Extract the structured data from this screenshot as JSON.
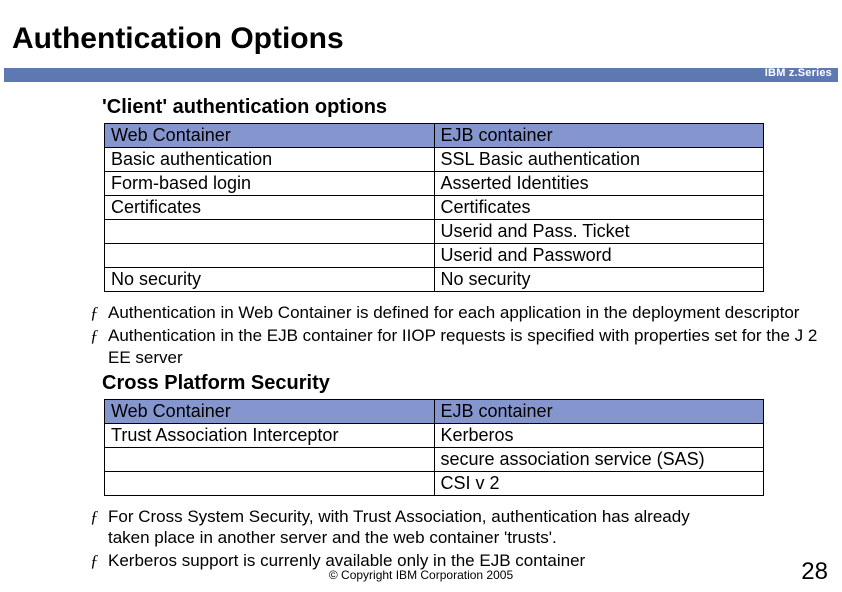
{
  "slide": {
    "title": "Authentication Options",
    "brand": "IBM z.Series",
    "section1": {
      "heading": "'Client' authentication options",
      "rows": [
        {
          "left": "Web Container",
          "right": "EJB container",
          "header": true
        },
        {
          "left": "Basic authentication",
          "right": "SSL Basic authentication"
        },
        {
          "left": "Form-based login",
          "right": "Asserted Identities"
        },
        {
          "left": "Certificates",
          "right": "Certificates"
        },
        {
          "left": "",
          "right": "Userid and Pass. Ticket"
        },
        {
          "left": "",
          "right": "Userid and Password"
        },
        {
          "left": "No security",
          "right": "No security"
        }
      ]
    },
    "bullets1": [
      "Authentication in Web Container is defined for each application in the deployment descriptor",
      "Authentication in the EJB container for IIOP requests is specified with properties set for the J 2 EE server"
    ],
    "section2": {
      "heading": "Cross Platform Security",
      "rows": [
        {
          "left": "Web Container",
          "right": "EJB container",
          "header": true
        },
        {
          "left": "Trust Association Interceptor",
          "right": "Kerberos"
        },
        {
          "left": "",
          "right": "secure association service (SAS)"
        },
        {
          "left": "",
          "right": "CSI v 2"
        }
      ]
    },
    "bullets2": [
      "For Cross System Security, with Trust Association, authentication has already taken place in another server and the web container 'trusts'.",
      "Kerberos support is currenly available only in the EJB container"
    ],
    "copyright": "© Copyright IBM Corporation 2005",
    "page_number": "28",
    "bullet_mark": "ƒ"
  }
}
